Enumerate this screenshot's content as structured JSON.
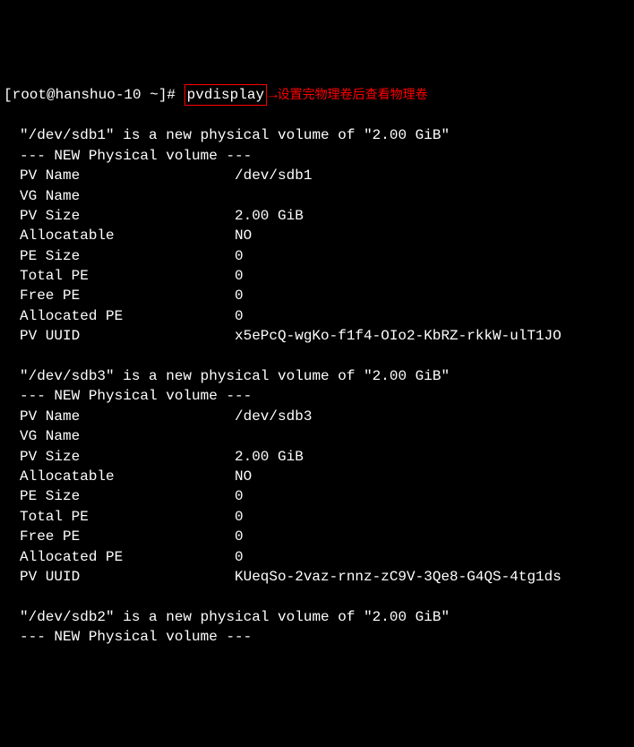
{
  "prompt": {
    "user_host": "[root@hanshuo-10 ~]# ",
    "command": "pvdisplay",
    "annotation": "设置完物理卷后查看物理卷"
  },
  "volumes": [
    {
      "header": "\"/dev/sdb1\" is a new physical volume of \"2.00 GiB\"",
      "section": "--- NEW Physical volume ---",
      "fields": [
        {
          "label": "PV Name",
          "value": "/dev/sdb1"
        },
        {
          "label": "VG Name",
          "value": ""
        },
        {
          "label": "PV Size",
          "value": "2.00 GiB"
        },
        {
          "label": "Allocatable",
          "value": "NO"
        },
        {
          "label": "PE Size",
          "value": "0"
        },
        {
          "label": "Total PE",
          "value": "0"
        },
        {
          "label": "Free PE",
          "value": "0"
        },
        {
          "label": "Allocated PE",
          "value": "0"
        },
        {
          "label": "PV UUID",
          "value": "x5ePcQ-wgKo-f1f4-OIo2-KbRZ-rkkW-ulT1JO"
        }
      ]
    },
    {
      "header": "\"/dev/sdb3\" is a new physical volume of \"2.00 GiB\"",
      "section": "--- NEW Physical volume ---",
      "fields": [
        {
          "label": "PV Name",
          "value": "/dev/sdb3"
        },
        {
          "label": "VG Name",
          "value": ""
        },
        {
          "label": "PV Size",
          "value": "2.00 GiB"
        },
        {
          "label": "Allocatable",
          "value": "NO"
        },
        {
          "label": "PE Size",
          "value": "0"
        },
        {
          "label": "Total PE",
          "value": "0"
        },
        {
          "label": "Free PE",
          "value": "0"
        },
        {
          "label": "Allocated PE",
          "value": "0"
        },
        {
          "label": "PV UUID",
          "value": "KUeqSo-2vaz-rnnz-zC9V-3Qe8-G4QS-4tg1ds"
        }
      ]
    },
    {
      "header": "\"/dev/sdb2\" is a new physical volume of \"2.00 GiB\"",
      "section": "--- NEW Physical volume ---",
      "fields": []
    }
  ]
}
